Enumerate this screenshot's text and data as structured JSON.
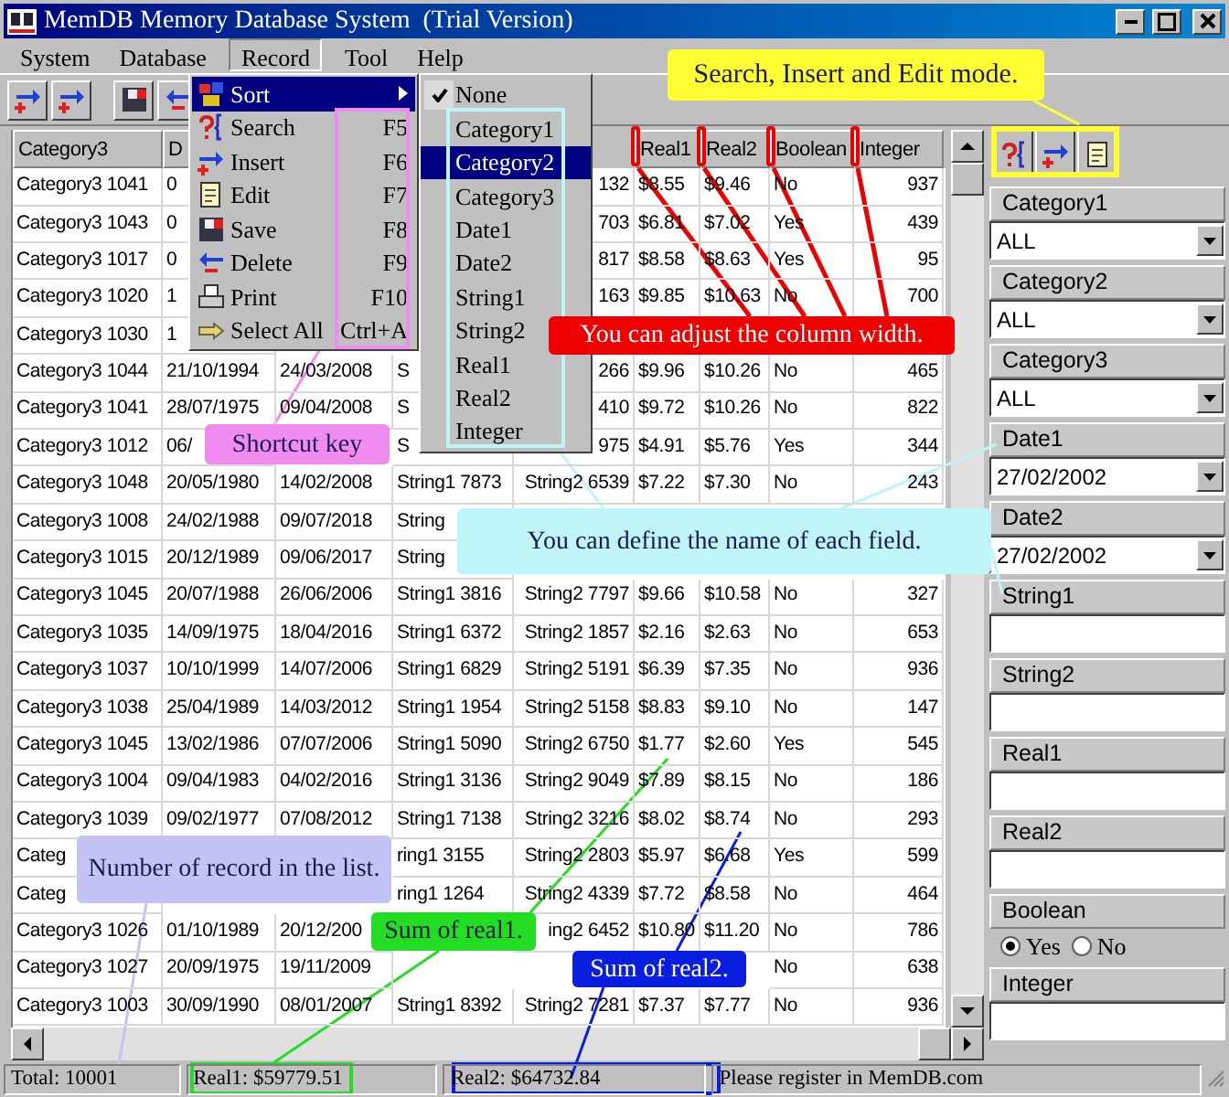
{
  "window": {
    "title": "MemDB Memory Database System  (Trial Version)"
  },
  "menu_bar": [
    {
      "label": "System",
      "open": false
    },
    {
      "label": "Database",
      "open": false
    },
    {
      "label": "Record",
      "open": true
    },
    {
      "label": "Tool",
      "open": false
    },
    {
      "label": "Help",
      "open": false
    }
  ],
  "record_menu": [
    {
      "kind": "submenu",
      "label": "Sort",
      "selected": true
    },
    {
      "kind": "command",
      "label": "Search",
      "shortcut": "F5",
      "selected": false
    },
    {
      "kind": "command",
      "label": "Insert",
      "shortcut": "F6",
      "selected": false
    },
    {
      "kind": "command",
      "label": "Edit",
      "shortcut": "F7",
      "selected": false
    },
    {
      "kind": "command",
      "label": "Save",
      "shortcut": "F8",
      "selected": false
    },
    {
      "kind": "command",
      "label": "Delete",
      "shortcut": "F9",
      "selected": false
    },
    {
      "kind": "command",
      "label": "Print",
      "shortcut": "F10",
      "selected": false
    },
    {
      "kind": "command",
      "label": "Select All",
      "shortcut": "Ctrl+A",
      "selected": false
    }
  ],
  "sort_submenu": [
    {
      "label": "None",
      "checked": true,
      "selected": false
    },
    {
      "label": "Category1",
      "checked": false,
      "selected": false
    },
    {
      "label": "Category2",
      "checked": false,
      "selected": true
    },
    {
      "label": "Category3",
      "checked": false,
      "selected": false
    },
    {
      "label": "Date1",
      "checked": false,
      "selected": false
    },
    {
      "label": "Date2",
      "checked": false,
      "selected": false
    },
    {
      "label": "String1",
      "checked": false,
      "selected": false
    },
    {
      "label": "String2",
      "checked": false,
      "selected": false
    },
    {
      "label": "Real1",
      "checked": false,
      "selected": false
    },
    {
      "label": "Real2",
      "checked": false,
      "selected": false
    },
    {
      "label": "Integer",
      "checked": false,
      "selected": false
    }
  ],
  "table": {
    "columns": [
      "Category3",
      "D",
      null,
      null,
      null,
      "Real1",
      "Real2",
      "Boolean",
      "Integer"
    ],
    "rows": [
      [
        "Category3 1041",
        "0",
        null,
        null,
        "132",
        "$8.55",
        "$9.46",
        "No",
        "937"
      ],
      [
        "Category3 1043",
        "0",
        null,
        null,
        "703",
        "$6.81",
        "$7.02",
        "Yes",
        "439"
      ],
      [
        "Category3 1017",
        "0",
        null,
        null,
        "817",
        "$8.58",
        "$8.63",
        "Yes",
        "95"
      ],
      [
        "Category3 1020",
        "1",
        null,
        null,
        "163",
        "$9.85",
        "$10.63",
        "No",
        "700"
      ],
      [
        "Category3 1030",
        "1",
        null,
        null,
        null,
        null,
        null,
        null,
        null
      ],
      [
        "Category3 1044",
        "21/10/1994",
        "24/03/2008",
        "S",
        "266",
        "$9.96",
        "$10.26",
        "No",
        "465"
      ],
      [
        "Category3 1041",
        "28/07/1975",
        "09/04/2008",
        "S",
        "410",
        "$9.72",
        "$10.26",
        "No",
        "822"
      ],
      [
        "Category3 1012",
        "06/",
        null,
        "S",
        "975",
        "$4.91",
        "$5.76",
        "Yes",
        "344"
      ],
      [
        "Category3 1048",
        "20/05/1980",
        "14/02/2008",
        "String1 7873",
        "String2 6539",
        "$7.22",
        "$7.30",
        "No",
        "243"
      ],
      [
        "Category3 1008",
        "24/02/1988",
        "09/07/2018",
        "String",
        null,
        null,
        null,
        null,
        null
      ],
      [
        "Category3 1015",
        "20/12/1989",
        "09/06/2017",
        "String",
        null,
        null,
        null,
        null,
        null
      ],
      [
        "Category3 1045",
        "20/07/1988",
        "26/06/2006",
        "String1 3816",
        "String2 7797",
        "$9.66",
        "$10.58",
        "No",
        "327"
      ],
      [
        "Category3 1035",
        "14/09/1975",
        "18/04/2016",
        "String1 6372",
        "String2 1857",
        "$2.16",
        "$2.63",
        "No",
        "653"
      ],
      [
        "Category3 1037",
        "10/10/1999",
        "14/07/2006",
        "String1 6829",
        "String2 5191",
        "$6.39",
        "$7.35",
        "No",
        "936"
      ],
      [
        "Category3 1038",
        "25/04/1989",
        "14/03/2012",
        "String1 1954",
        "String2 5158",
        "$8.83",
        "$9.10",
        "No",
        "147"
      ],
      [
        "Category3 1045",
        "13/02/1986",
        "07/07/2006",
        "String1 5090",
        "String2 6750",
        "$1.77",
        "$2.60",
        "Yes",
        "545"
      ],
      [
        "Category3 1004",
        "09/04/1983",
        "04/02/2016",
        "String1 3136",
        "String2 9049",
        "$7.89",
        "$8.15",
        "No",
        "186"
      ],
      [
        "Category3 1039",
        "09/02/1977",
        "07/08/2012",
        "String1 7138",
        "String2 3216",
        "$8.02",
        "$8.74",
        "No",
        "293"
      ],
      [
        "Categ",
        null,
        null,
        "ring1 3155",
        "String2 2803",
        "$5.97",
        "$6.68",
        "Yes",
        "599"
      ],
      [
        "Categ",
        null,
        null,
        "ring1 1264",
        "String2 4339",
        "$7.72",
        "$8.58",
        "No",
        "464"
      ],
      [
        "Category3 1026",
        "01/10/1989",
        "20/12/200",
        null,
        "ing2 6452",
        "$10.80",
        "$11.20",
        "No",
        "786"
      ],
      [
        "Category3 1027",
        "20/09/1975",
        "19/11/2009",
        null,
        null,
        null,
        null,
        "No",
        "638"
      ],
      [
        "Category3 1003",
        "30/09/1990",
        "08/01/2007",
        "String1 8392",
        "String2 7281",
        "$7.37",
        "$7.77",
        "No",
        "936"
      ]
    ]
  },
  "side_panel": [
    {
      "kind": "dropdown",
      "label": "Category1",
      "value": "ALL"
    },
    {
      "kind": "dropdown",
      "label": "Category2",
      "value": "ALL"
    },
    {
      "kind": "dropdown",
      "label": "Category3",
      "value": "ALL"
    },
    {
      "kind": "dropdown",
      "label": "Date1",
      "value": "27/02/2002"
    },
    {
      "kind": "dropdown",
      "label": "Date2",
      "value": "27/02/2002"
    },
    {
      "kind": "text",
      "label": "String1"
    },
    {
      "kind": "text",
      "label": "String2"
    },
    {
      "kind": "text",
      "label": "Real1"
    },
    {
      "kind": "text",
      "label": "Real2"
    },
    {
      "kind": "radio",
      "label": "Boolean",
      "options": [
        {
          "label": "Yes",
          "selected": true
        },
        {
          "label": "No",
          "selected": false
        }
      ]
    },
    {
      "kind": "text",
      "label": "Integer"
    }
  ],
  "status_bar": [
    {
      "text": "Total: 10001"
    },
    {
      "text": "Real1: $59779.51"
    },
    {
      "text": "Real2: $64732.84"
    },
    {
      "text": "Please register in MemDB.com"
    }
  ],
  "annotations": [
    {
      "text": "Search, Insert and Edit mode.",
      "color": "#ffff33"
    },
    {
      "text": "Shortcut key",
      "color": "#f08cf0"
    },
    {
      "text": "You can adjust the column width.",
      "color": "#ee0000"
    },
    {
      "text": "You can define the name of each field.",
      "color": "#bff5f8"
    },
    {
      "text": "Number of record in the list.",
      "color": "#c4c4f4"
    },
    {
      "text": "Sum of real1.",
      "color": "#22dd22"
    },
    {
      "text": "Sum of real2.",
      "color": "#0a1ee0"
    }
  ]
}
